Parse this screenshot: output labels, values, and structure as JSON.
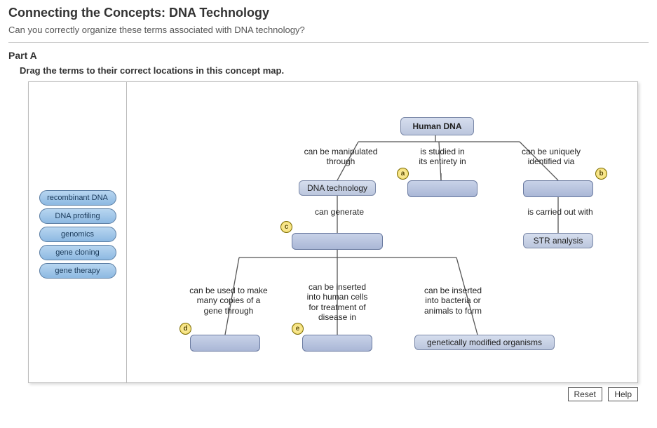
{
  "title": "Connecting the Concepts: DNA Technology",
  "subtitle": "Can you correctly organize these terms associated with DNA technology?",
  "part_label": "Part A",
  "instruction": "Drag the terms to their correct locations in this concept map.",
  "terms": [
    "recombinant DNA",
    "DNA profiling",
    "genomics",
    "gene cloning",
    "gene therapy"
  ],
  "nodes": {
    "root": "Human DNA",
    "dna_tech": "DNA technology",
    "str": "STR analysis",
    "gmo": "genetically modified organisms"
  },
  "links": {
    "manip": "can be manipulated\nthrough",
    "studied": "is studied in\nits entirety in",
    "unique": "can be uniquely\nidentified via",
    "generate": "can generate",
    "carried": "is carried out with",
    "copies": "can be used to make\nmany copies of a\ngene through",
    "inserted_human": "can be inserted\ninto human cells\nfor treatment of\ndisease in",
    "inserted_bact": "can be inserted\ninto bacteria or\nanimals to form"
  },
  "markers": {
    "a": "a",
    "b": "b",
    "c": "c",
    "d": "d",
    "e": "e"
  },
  "buttons": {
    "reset": "Reset",
    "help": "Help"
  }
}
